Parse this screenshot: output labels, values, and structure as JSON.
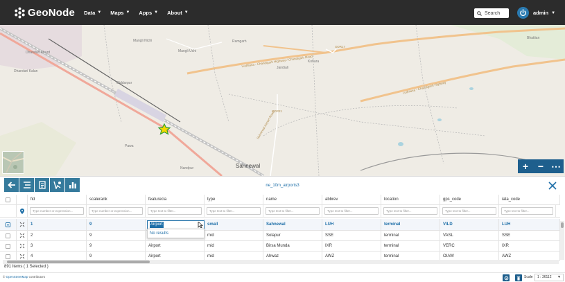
{
  "navbar": {
    "brand": "GeoNode",
    "menu": [
      {
        "label": "Data"
      },
      {
        "label": "Maps"
      },
      {
        "label": "Apps"
      },
      {
        "label": "About"
      }
    ],
    "search_placeholder": "Search",
    "user": "admin"
  },
  "map": {
    "labels": {
      "dhandari_khurd": "Dhandari Khurd",
      "dhandari_kalan": "Dhandari Kalan",
      "mangli_nichi": "Mangli Nichi",
      "mangli_uchi": "Mangli Uchi",
      "ramgarh": "Ramgarh",
      "jandiali": "Jandiali",
      "kohara": "Kohara",
      "sahnewal": "Sahnewal",
      "giddarpur": "Giddarpur",
      "pawa": "Pawa",
      "nandpur": "Nandpur",
      "bhattian": "Bhattian",
      "odr17": "ODR17",
      "odr21": "ODR21",
      "highway1": "Ludhiana - Chandigarh Highway / Chandigarh Road",
      "highway2": "Ludhiana - Chandigarh Highway",
      "odr_road": "Sahnewal Airport Road"
    },
    "tools": [
      "+",
      "−",
      "⋯"
    ]
  },
  "feature_grid": {
    "layer_title": "ne_10m_airports3",
    "columns": [
      "fid",
      "scalerank",
      "featurecla",
      "type",
      "name",
      "abbrev",
      "location",
      "gps_code",
      "iata_code"
    ],
    "filter_placeholders": [
      "Type number or expression...",
      "Type number or expression...",
      "Type text to filter...",
      "Type text to filter...",
      "Type text to filter...",
      "Type text to filter...",
      "Type text to filter...",
      "Type text to filter...",
      "Type text to filter..."
    ],
    "rows": [
      {
        "fid": "1",
        "scalerank": "9",
        "featurecla": "Airport",
        "type": "small",
        "name": "Sahnewal",
        "abbrev": "LUH",
        "location": "terminal",
        "gps_code": "VILD",
        "iata_code": "LUH",
        "selected": true
      },
      {
        "fid": "2",
        "scalerank": "9",
        "featurecla": "Airport",
        "type": "mid",
        "name": "Solapur",
        "abbrev": "SSE",
        "location": "terminal",
        "gps_code": "VASL",
        "iata_code": "SSE",
        "selected": false
      },
      {
        "fid": "3",
        "scalerank": "9",
        "featurecla": "Airport",
        "type": "mid",
        "name": "Birsa Munda",
        "abbrev": "IXR",
        "location": "terminal",
        "gps_code": "VERC",
        "iata_code": "IXR",
        "selected": false
      },
      {
        "fid": "4",
        "scalerank": "9",
        "featurecla": "Airport",
        "type": "mid",
        "name": "Ahwaz",
        "abbrev": "AWZ",
        "location": "terminal",
        "gps_code": "OIAW",
        "iata_code": "AWZ",
        "selected": false
      }
    ],
    "dropdown_message": "No results",
    "status": "891 Items ( 1 Selected )"
  },
  "footer": {
    "attribution_prefix": "©",
    "attribution_link": "OpenStreetMap",
    "attribution_suffix": "contributors",
    "scale_label": "Scale",
    "scale_value": "1 : 36112"
  },
  "colors": {
    "navbar": "#2c2c2c",
    "accent": "#1e6fa8",
    "toolbar": "#357a9c"
  }
}
